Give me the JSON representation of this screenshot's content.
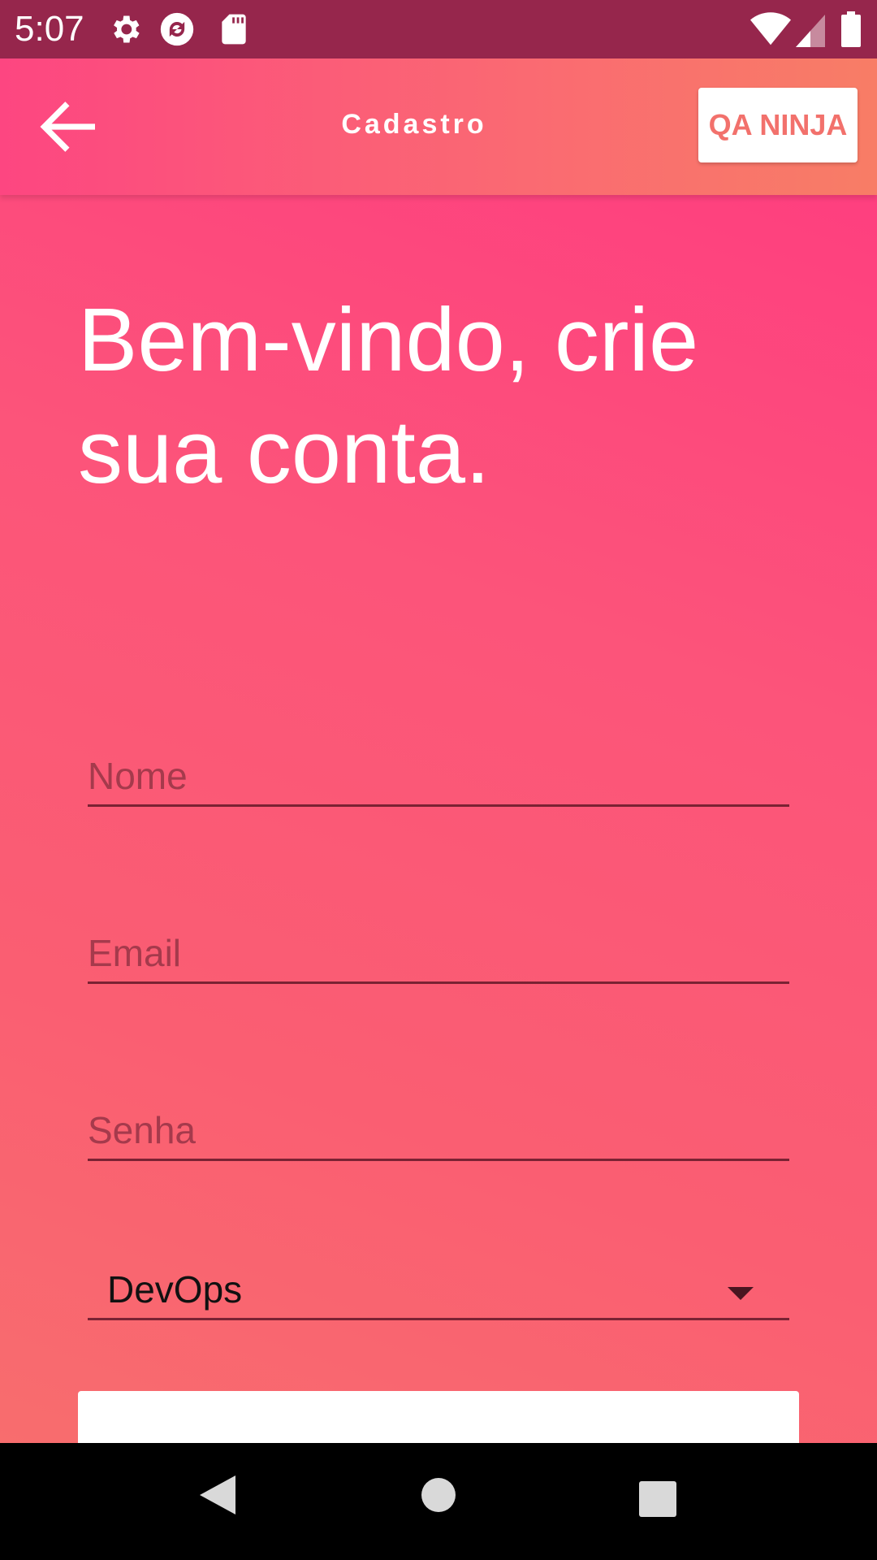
{
  "status_bar": {
    "time": "5:07",
    "icons_left": [
      "settings-icon",
      "sync-icon",
      "sd-card-icon"
    ],
    "icons_right": [
      "wifi-icon",
      "cell-signal-icon",
      "battery-icon"
    ]
  },
  "app_bar": {
    "back_icon": "arrow-left-icon",
    "title": "Cadastro",
    "action_label": "QA NINJA"
  },
  "main": {
    "welcome_text": "Bem-vindo, crie sua conta.",
    "fields": {
      "name_placeholder": "Nome",
      "email_placeholder": "Email",
      "password_placeholder": "Senha"
    },
    "role_select": {
      "selected": "DevOps"
    }
  },
  "nav_bar": {
    "icons": [
      "back-triangle-icon",
      "home-circle-icon",
      "recents-square-icon"
    ]
  },
  "colors": {
    "status_bar": "#96264C",
    "accent_pink": "#FE3F7F",
    "accent_coral": "#F86D6E",
    "button_text": "#F2716C"
  }
}
